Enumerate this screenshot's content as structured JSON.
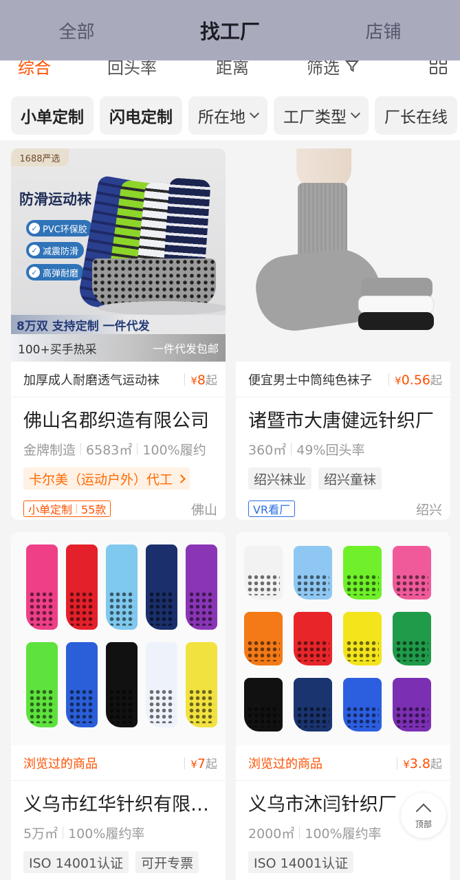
{
  "top_tabs": [
    "全部",
    "找工厂",
    "店铺"
  ],
  "sort": {
    "items": [
      "综合",
      "回头率",
      "距离",
      "筛选"
    ]
  },
  "filters": [
    "小单定制",
    "闪电定制",
    "所在地",
    "工厂类型",
    "厂长在线"
  ],
  "cards": [
    {
      "image_badge": "1688严选",
      "image_title": "防滑运动袜",
      "image_benefits": [
        "PVC环保胶",
        "减震防滑",
        "高弹耐磨"
      ],
      "image_caption_left": "100+买手热采",
      "image_caption_right": "一件代发包邮",
      "image_bottom_text": "8万双  支持定制 一件代发",
      "product": "加厚成人耐磨透气运动袜",
      "price_symbol": "¥",
      "price": "8",
      "price_suffix": "起",
      "factory": "佛山名郡织造有限公司",
      "stats": [
        "金牌制造",
        "6583㎡",
        "100%履约"
      ],
      "tags": [
        "卡尔美（运动户外）代工"
      ],
      "badge_left": "小单定制",
      "badge_right": "55款",
      "city": "佛山"
    },
    {
      "product": "便宜男士中筒纯色袜子",
      "price_symbol": "¥",
      "price": "0.56",
      "price_suffix": "起",
      "factory": "诸暨市大唐健远针织厂",
      "stats": [
        "360㎡",
        "49%回头率"
      ],
      "tags": [
        "绍兴袜业",
        "绍兴童袜"
      ],
      "badge": "VR看厂",
      "city": "绍兴"
    },
    {
      "product": "浏览过的商品",
      "price_symbol": "¥",
      "price": "7",
      "price_suffix": "起",
      "factory": "义乌市红华针织有限公司",
      "stats": [
        "5万㎡",
        "100%履约率"
      ],
      "tags": [
        "ISO 14001认证",
        "可开专票"
      ]
    },
    {
      "product": "浏览过的商品",
      "price_symbol": "¥",
      "price": "3.8",
      "price_suffix": "起",
      "factory": "义乌市沐闫针织厂",
      "stats": [
        "2000㎡",
        "100%履约率"
      ],
      "tags": [
        "ISO 14001认证"
      ]
    }
  ],
  "back_to_top": "顶部",
  "colors": {
    "accent": "#ff5000",
    "overlay": "#a9abbd",
    "vr_blue": "#2a6ee0"
  }
}
